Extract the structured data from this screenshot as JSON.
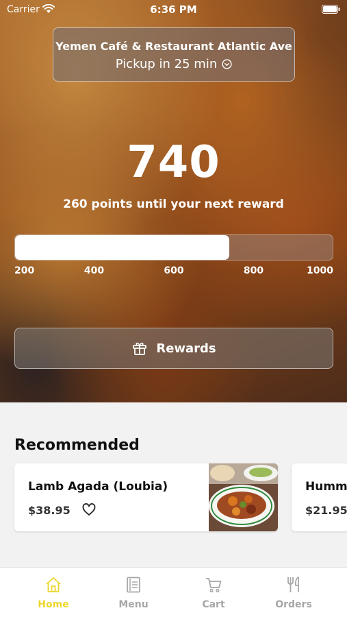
{
  "status_bar": {
    "carrier": "Carrier",
    "time": "6:36 PM"
  },
  "location": {
    "name": "Yemen Café & Restaurant Atlantic Ave",
    "pickup": "Pickup in 25 min"
  },
  "rewards": {
    "points": "740",
    "caption": "260 points until your next reward",
    "progress_min": 200,
    "progress_max": 1000,
    "progress_value": 740,
    "ticks": [
      "200",
      "400",
      "600",
      "800",
      "1000"
    ],
    "button_label": "Rewards"
  },
  "recommended": {
    "title": "Recommended",
    "items": [
      {
        "name": "Lamb Agada (Loubia)",
        "price": "$38.95"
      },
      {
        "name": "Humm",
        "price": "$21.95"
      }
    ]
  },
  "tabs": [
    {
      "label": "Home",
      "icon": "home-icon",
      "active": true
    },
    {
      "label": "Menu",
      "icon": "menu-icon",
      "active": false
    },
    {
      "label": "Cart",
      "icon": "cart-icon",
      "active": false
    },
    {
      "label": "Orders",
      "icon": "fork-knife-icon",
      "active": false
    }
  ],
  "colors": {
    "accent": "#ecd730",
    "tab_inactive": "#a7a7a7"
  }
}
